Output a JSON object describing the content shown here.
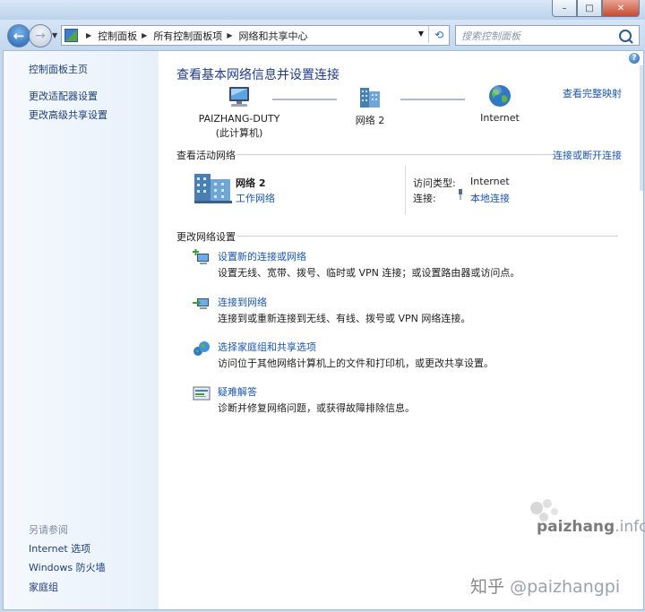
{
  "window": {
    "min_symbol": "–",
    "max_symbol": "□",
    "close_symbol": "✕"
  },
  "nav": {
    "back_symbol": "←",
    "forward_symbol": "→",
    "breadcrumbs": [
      "控制面板",
      "所有控制面板项",
      "网络和共享中心"
    ],
    "search_placeholder": "搜索控制面板"
  },
  "sidebar": {
    "home": "控制面板主页",
    "links": [
      "更改适配器设置",
      "更改高级共享设置"
    ],
    "see_also_label": "另请参阅",
    "see_also": [
      "Internet 选项",
      "Windows 防火墙",
      "家庭组"
    ]
  },
  "main": {
    "help_symbol": "?",
    "title": "查看基本网络信息并设置连接",
    "full_map_link": "查看完整映射",
    "nodes": {
      "computer_name": "PAIZHANG-DUTY",
      "computer_sub": "(此计算机)",
      "network": "网络  2",
      "internet": "Internet"
    },
    "active_header": "查看活动网络",
    "connect_link": "连接或断开连接",
    "active": {
      "name": "网络  2",
      "type": "工作网络",
      "access_label": "访问类型:",
      "access_value": "Internet",
      "conn_label": "连接:",
      "conn_value": "本地连接"
    },
    "settings_header": "更改网络设置",
    "tasks": [
      {
        "link": "设置新的连接或网络",
        "desc": "设置无线、宽带、拨号、临时或 VPN 连接；或设置路由器或访问点。",
        "icon": "new-connection-icon"
      },
      {
        "link": "连接到网络",
        "desc": "连接到或重新连接到无线、有线、拨号或 VPN 网络连接。",
        "icon": "connect-network-icon"
      },
      {
        "link": "选择家庭组和共享选项",
        "desc": "访问位于其他网络计算机上的文件和打印机，或更改共享设置。",
        "icon": "homegroup-icon"
      },
      {
        "link": "疑难解答",
        "desc": "诊断并修复网络问题，或获得故障排除信息。",
        "icon": "troubleshoot-icon"
      }
    ]
  },
  "watermarks": {
    "site_main": "paizhang",
    "site_ext": ".info",
    "zhihu": "知乎",
    "handle": "@paizhangpi"
  },
  "colors": {
    "link": "#1a56b5",
    "title": "#1e3b8f",
    "sidebar_link": "#1f3f7a"
  }
}
